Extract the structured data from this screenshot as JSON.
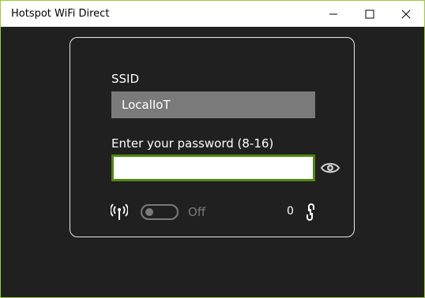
{
  "window": {
    "title": "Hotspot WiFi Direct",
    "controls": [
      "minimize",
      "maximize",
      "close"
    ]
  },
  "form": {
    "ssid_label": "SSID",
    "ssid_value": "LocalIoT",
    "password_label": "Enter your password (8-16)",
    "password_value": "",
    "show_password_icon": "eye-icon",
    "hotspot_icon": "antenna-icon",
    "toggle_state_text": "Off",
    "connected_count": "0",
    "connections_icon": "link-icon"
  },
  "colors": {
    "background": "#202020",
    "input_border_focus": "#4f8a10",
    "ssid_box": "#7a7a7a",
    "panel_border": "#e6e6e6"
  }
}
